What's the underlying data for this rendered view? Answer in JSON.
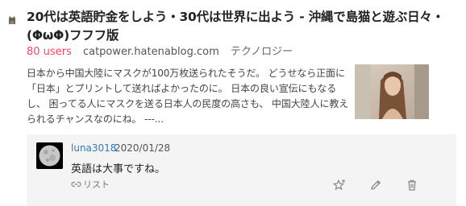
{
  "entry": {
    "title": "20代は英語貯金をしよう・30代は世界に出よう - 沖縄で島猫と遊ぶ日々・(ΦωΦ)フフフ版",
    "users": "80 users",
    "domain": "catpower.hatenablog.com",
    "category": "テクノロジー",
    "summary": "日本から中国大陸にマスクが100万枚送られたそうだ。 どうせなら正面に「日本」とプリントして送ればよかったのに。 日本の良い宣伝にもなるし、 困ってる人にマスクを送る日本人の民度の高さも、 中国大陸人に教えられるチャンスなのにね。 ---...",
    "favicon_icon": "cat-icon",
    "thumbnail": "woman-portrait-thumbnail"
  },
  "comment": {
    "user": "luna3018",
    "date": "2020/01/28",
    "text": "英語は大事ですね。",
    "list_label": "リスト",
    "avatar": "moon-avatar",
    "actions": [
      "star-add-icon",
      "edit-icon",
      "delete-icon"
    ]
  },
  "colors": {
    "users": "#ff4166",
    "username": "#2e7cb9",
    "comment_bg": "#f4f4f4"
  }
}
